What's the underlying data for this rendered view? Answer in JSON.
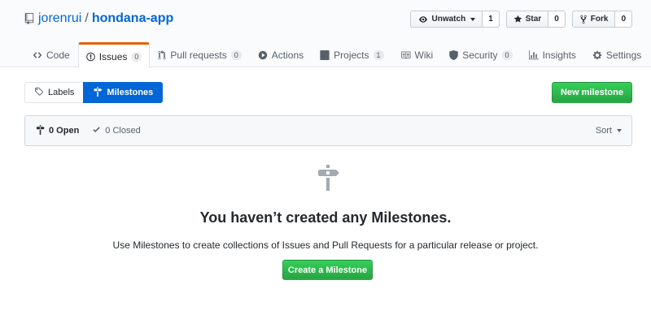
{
  "repo": {
    "owner": "jorenrui",
    "separator": "/",
    "name": "hondana-app",
    "icon": "repo-icon"
  },
  "actions": {
    "watch": {
      "label": "Unwatch",
      "count": "1",
      "icon": "eye-icon"
    },
    "star": {
      "label": "Star",
      "count": "0",
      "icon": "star-icon"
    },
    "fork": {
      "label": "Fork",
      "count": "0",
      "icon": "fork-icon"
    }
  },
  "reponav": {
    "selected": "Issues",
    "items": [
      {
        "label": "Code",
        "icon": "code-icon",
        "counter": null
      },
      {
        "label": "Issues",
        "icon": "issue-icon",
        "counter": "0"
      },
      {
        "label": "Pull requests",
        "icon": "pull-request-icon",
        "counter": "0"
      },
      {
        "label": "Actions",
        "icon": "play-icon",
        "counter": null
      },
      {
        "label": "Projects",
        "icon": "project-icon",
        "counter": "1"
      },
      {
        "label": "Wiki",
        "icon": "book-icon",
        "counter": null
      },
      {
        "label": "Security",
        "icon": "shield-icon",
        "counter": "0"
      },
      {
        "label": "Insights",
        "icon": "graph-icon",
        "counter": null
      },
      {
        "label": "Settings",
        "icon": "gear-icon",
        "counter": null
      }
    ]
  },
  "subnav": {
    "labels": "Labels",
    "milestones": "Milestones",
    "selected": "Milestones"
  },
  "new_milestone": "New milestone",
  "states": {
    "open": "0 Open",
    "closed": "0 Closed",
    "selected": "open"
  },
  "sort": "Sort",
  "blankslate": {
    "icon": "milestone-icon",
    "title": "You haven’t created any Milestones.",
    "description": "Use Milestones to create collections of Issues and Pull Requests for a particular release or project.",
    "button": "Create a Milestone"
  },
  "colors": {
    "link": "#0366d6",
    "selected_tab_accent": "#e36209",
    "primary_button": "#28a745",
    "subnav_selected": "#0366d6"
  }
}
